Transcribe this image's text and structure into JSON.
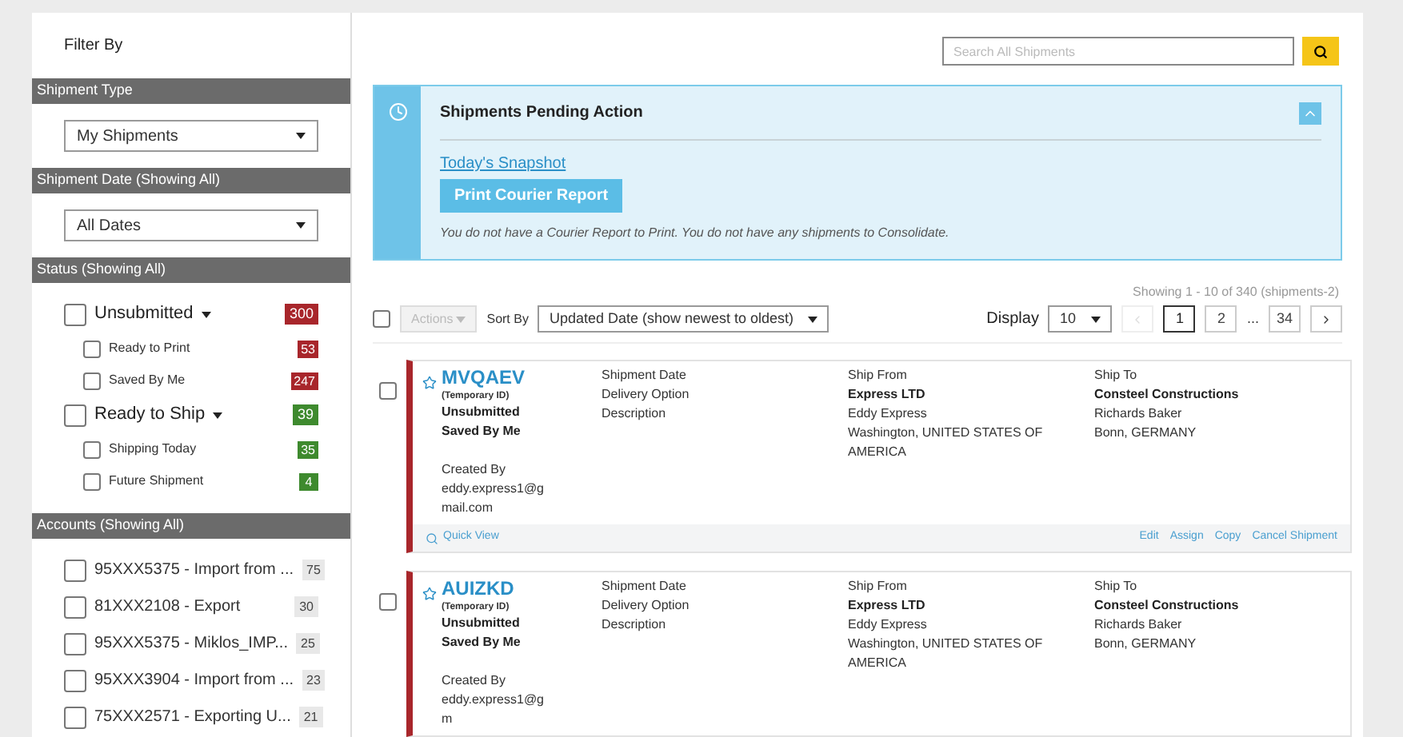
{
  "sidebar": {
    "title": "Filter By",
    "sections": [
      {
        "kind": "select",
        "heading": "Shipment Type",
        "value": "My Shipments"
      },
      {
        "kind": "select",
        "heading": "Shipment Date (Showing All)",
        "value": "All Dates"
      },
      {
        "kind": "status",
        "heading": "Status (Showing All)",
        "items": [
          {
            "label": "Unsubmitted",
            "checked": false,
            "count": "300",
            "color": "#a8262b",
            "children": [
              {
                "label": "Ready to Print",
                "checked": false,
                "count": "53",
                "color": "#a8262b"
              },
              {
                "label": "Saved By Me",
                "checked": false,
                "count": "247",
                "color": "#a8262b"
              }
            ]
          },
          {
            "label": "Ready to Ship",
            "checked": false,
            "count": "39",
            "color": "#3e8a2e",
            "children": [
              {
                "label": "Shipping Today",
                "checked": false,
                "count": "35",
                "color": "#3e8a2e"
              },
              {
                "label": "Future Shipment",
                "checked": false,
                "count": "4",
                "color": "#3e8a2e"
              }
            ]
          }
        ]
      },
      {
        "kind": "accounts",
        "heading": "Accounts (Showing All)",
        "items": [
          {
            "label": "95XXX5375 - Import from ...",
            "checked": false,
            "count": "75"
          },
          {
            "label": "81XXX2108 - Export",
            "checked": false,
            "count": "30"
          },
          {
            "label": "95XXX5375 - Miklos_IMP...",
            "checked": false,
            "count": "25"
          },
          {
            "label": "95XXX3904 - Import from ...",
            "checked": false,
            "count": "23"
          },
          {
            "label": "75XXX2571 - Exporting U...",
            "checked": false,
            "count": "21"
          }
        ]
      }
    ]
  },
  "search": {
    "placeholder": "Search All Shipments"
  },
  "pending": {
    "title": "Shipments Pending Action",
    "expanded": true,
    "link": "Today's Snapshot",
    "button": "Print Courier Report",
    "note": "You do not have a Courier Report to Print. You do not have any shipments to Consolidate."
  },
  "toolbar": {
    "showing": "Showing 1 - 10 of 340 (shipments-2)",
    "select_all": false,
    "actions": "Actions",
    "actions_disabled": true,
    "sort_label": "Sort By",
    "sort_value": "Updated Date (show newest to oldest)",
    "display_label": "Display",
    "display_value": "10",
    "prev_disabled": true,
    "pages": [
      {
        "kind": "page",
        "label": "1",
        "selected": true
      },
      {
        "kind": "page",
        "label": "2",
        "selected": false
      },
      {
        "kind": "gap",
        "label": "..."
      },
      {
        "kind": "page",
        "label": "34",
        "selected": false
      }
    ]
  },
  "shipments": [
    {
      "checked": false,
      "id": "MVQAEV",
      "id_note": "(Temporary ID)",
      "status": "Unsubmitted",
      "saved": "Saved By Me",
      "created_label": "Created By",
      "created_by": "eddy.express1@gmail.com",
      "details": [
        "Shipment Date",
        "Delivery Option",
        "Description"
      ],
      "ship_from": {
        "label": "Ship From",
        "company": "Express LTD",
        "lines": [
          "Eddy Express",
          "Washington, UNITED STATES OF AMERICA"
        ]
      },
      "ship_to": {
        "label": "Ship To",
        "company": "Consteel Constructions",
        "lines": [
          "Richards Baker",
          "Bonn, GERMANY"
        ]
      },
      "footer": {
        "quick_view": "Quick View",
        "actions": [
          "Edit",
          "Assign",
          "Copy",
          "Cancel Shipment"
        ]
      }
    },
    {
      "checked": false,
      "id": "AUIZKD",
      "id_note": "(Temporary ID)",
      "status": "Unsubmitted",
      "saved": "Saved By Me",
      "created_label": "Created By",
      "created_by": "eddy.express1@gm",
      "details": [
        "Shipment Date",
        "Delivery Option",
        "Description"
      ],
      "ship_from": {
        "label": "Ship From",
        "company": "Express LTD",
        "lines": [
          "Eddy Express",
          "Washington, UNITED STATES OF AMERICA"
        ]
      },
      "ship_to": {
        "label": "Ship To",
        "company": "Consteel Constructions",
        "lines": [
          "Richards Baker",
          "Bonn, GERMANY"
        ]
      }
    }
  ]
}
